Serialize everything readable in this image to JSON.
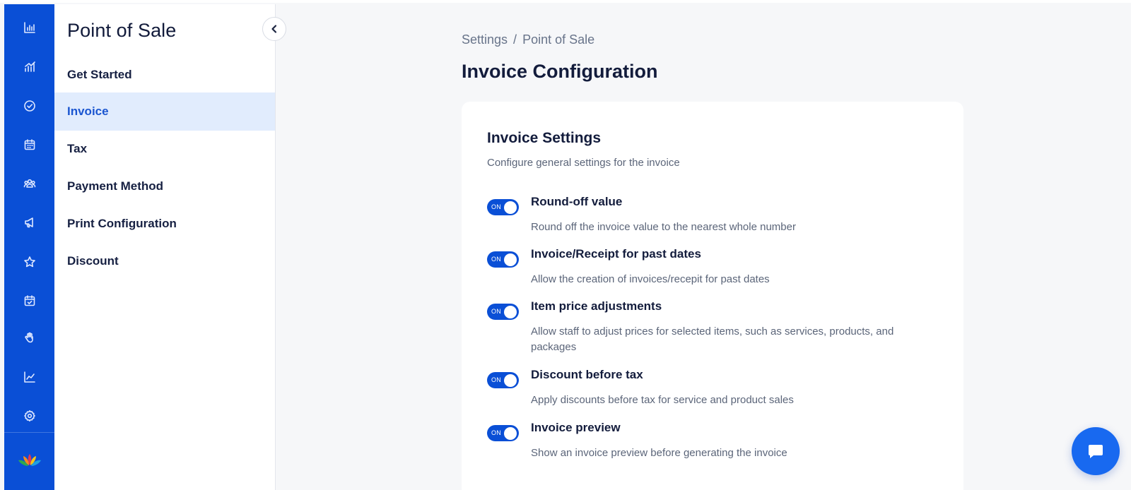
{
  "sidebar": {
    "title": "Point of Sale",
    "items": [
      {
        "label": "Get Started",
        "active": false
      },
      {
        "label": "Invoice",
        "active": true
      },
      {
        "label": "Tax",
        "active": false
      },
      {
        "label": "Payment Method",
        "active": false
      },
      {
        "label": "Print Configuration",
        "active": false
      },
      {
        "label": "Discount",
        "active": false
      }
    ]
  },
  "rail": {
    "icons": [
      "bar-chart-icon",
      "analytics-icon",
      "check-circle-icon",
      "calendar-icon",
      "team-icon",
      "megaphone-icon",
      "star-icon",
      "calendar-check-icon",
      "hand-icon",
      "trend-chart-icon",
      "settings-icon"
    ],
    "logo": "lotus-logo"
  },
  "breadcrumb": {
    "root": "Settings",
    "separator": "/",
    "current": "Point of Sale"
  },
  "page": {
    "title": "Invoice Configuration"
  },
  "card": {
    "title": "Invoice Settings",
    "description": "Configure general settings for the invoice",
    "settings": [
      {
        "toggle": "ON",
        "enabled": true,
        "title": "Round-off value",
        "description": "Round off the invoice value to the nearest whole number"
      },
      {
        "toggle": "ON",
        "enabled": true,
        "title": "Invoice/Receipt for past dates",
        "description": "Allow the creation of invoices/recepit for past dates"
      },
      {
        "toggle": "ON",
        "enabled": true,
        "title": "Item price adjustments",
        "description": "Allow staff to adjust prices for selected items, such as services, products, and packages"
      },
      {
        "toggle": "ON",
        "enabled": true,
        "title": "Discount before tax",
        "description": "Apply discounts before tax for service and product sales"
      },
      {
        "toggle": "ON",
        "enabled": true,
        "title": "Invoice preview",
        "description": "Show an invoice preview before generating the invoice"
      }
    ]
  },
  "colors": {
    "brand": "#0a4fd6",
    "active_nav_bg": "#e1ecfd",
    "active_nav_text": "#1a55d0",
    "chat_button": "#1869f0"
  },
  "chat": {
    "icon": "chat-bubble-icon"
  }
}
